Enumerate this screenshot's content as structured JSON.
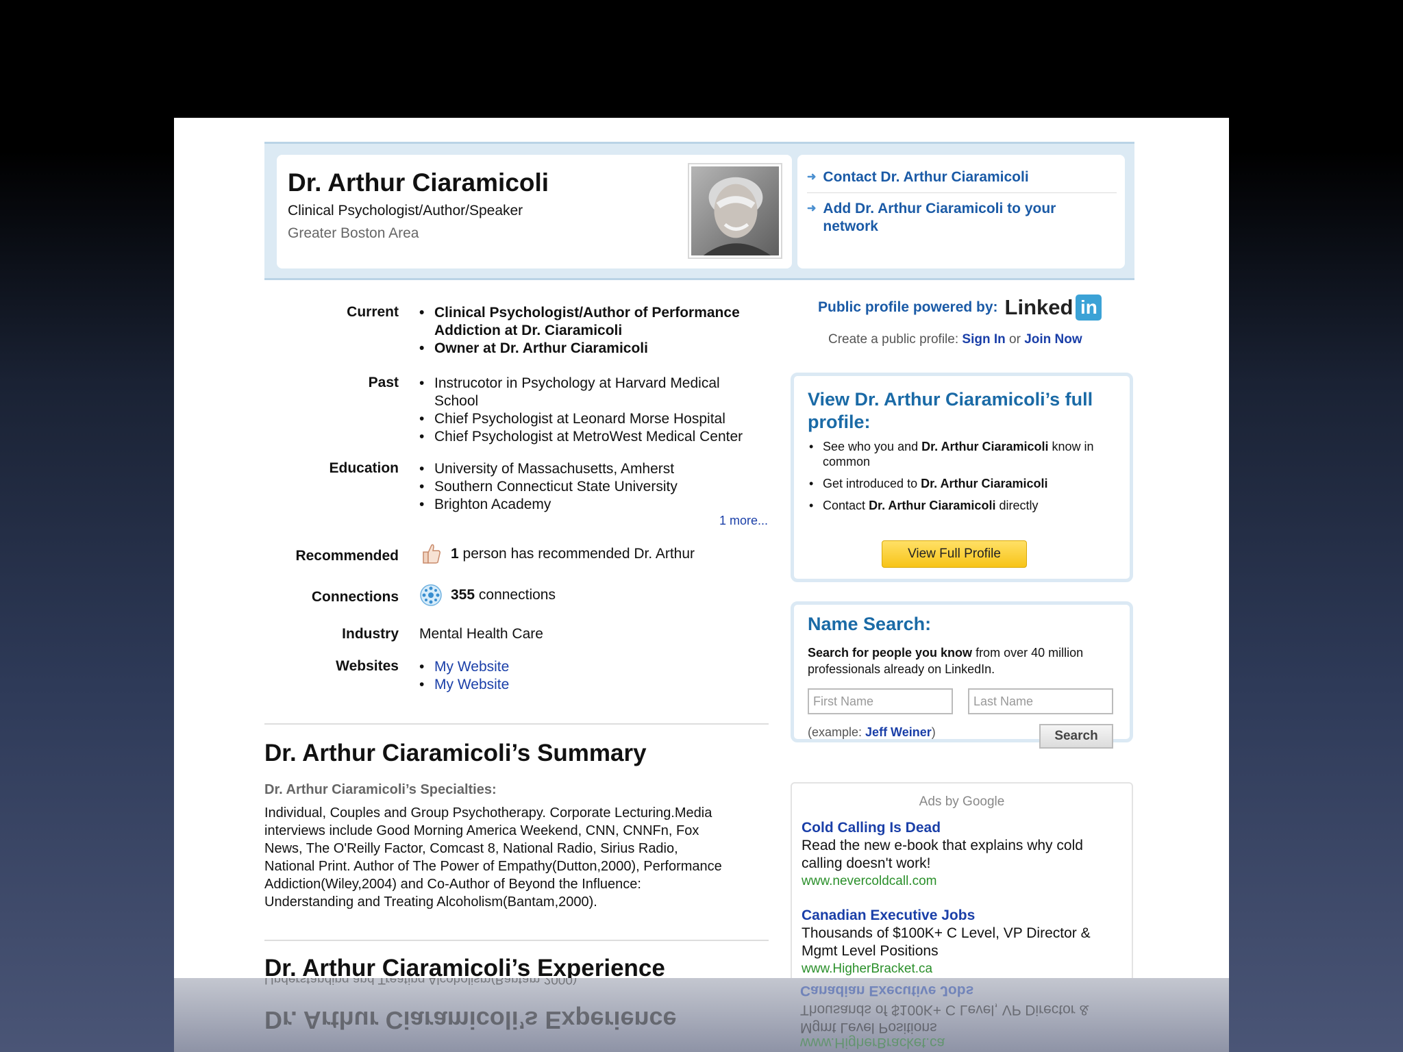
{
  "header": {
    "name": "Dr. Arthur Ciaramicoli",
    "headline": "Clinical Psychologist/Author/Speaker",
    "location": "Greater Boston Area",
    "actions": {
      "contact": "Contact Dr. Arthur Ciaramicoli",
      "add_line1": "Add Dr. Arthur Ciaramicoli to your",
      "add_line2": "network"
    }
  },
  "profile": {
    "current_label": "Current",
    "current": [
      "Clinical Psychologist/Author of Performance",
      "Addiction at Dr. Ciaramicoli",
      "Owner at Dr. Arthur Ciaramicoli"
    ],
    "past_label": "Past",
    "past": [
      "Instrucotor in Psychology at Harvard Medical",
      "School",
      "Chief Psychologist at Leonard Morse Hospital",
      "Chief Psychologist at MetroWest Medical Center"
    ],
    "education_label": "Education",
    "education": [
      "University of Massachusetts, Amherst",
      "Southern Connecticut State University",
      "Brighton Academy"
    ],
    "more_link": "1 more...",
    "recommended_label": "Recommended",
    "recommended_count": "1",
    "recommended_text": "person has recommended Dr. Arthur",
    "connections_label": "Connections",
    "connections_count": "355",
    "connections_text": "connections",
    "industry_label": "Industry",
    "industry": "Mental Health Care",
    "websites_label": "Websites",
    "websites": [
      "My Website",
      "My Website"
    ]
  },
  "summary": {
    "title": "Dr. Arthur Ciaramicoli’s Summary",
    "specialties_label": "Dr. Arthur Ciaramicoli’s Specialties:",
    "specialties_lines": [
      "Individual, Couples and Group Psychotherapy. Corporate Lecturing.Media",
      "interviews include Good Morning America Weekend, CNN, CNNFn, Fox",
      "News, The O'Reilly Factor, Comcast 8, National Radio, Sirius Radio,",
      "National Print. Author of The Power of Empathy(Dutton,2000), Performance",
      "Addiction(Wiley,2004) and Co-Author of Beyond the Influence:",
      "Understanding and Treating Alcoholism(Bantam,2000)."
    ],
    "experience_title": "Dr. Arthur Ciaramicoli’s Experience"
  },
  "sidebar": {
    "powered_by": "Public profile powered by:",
    "linkedin_word": "Linked",
    "linkedin_in": "in",
    "create_text": "Create a public profile:",
    "sign_in": "Sign In",
    "or": "or",
    "join_now": "Join Now",
    "full_profile": {
      "title_line1": "View Dr. Arthur Ciaramicoli’s full",
      "title_line2": "profile:",
      "b1_pre": "See who you and",
      "b1_name": "Dr. Arthur Ciaramicoli",
      "b1_post": "know in common",
      "b2_pre": "Get introduced to",
      "b2_name": "Dr. Arthur Ciaramicoli",
      "b3_pre": "Contact",
      "b3_name": "Dr. Arthur Ciaramicoli",
      "b3_post": "directly",
      "button": "View Full Profile"
    },
    "name_search": {
      "title": "Name Search:",
      "desc_bold": "Search for people you know",
      "desc_rest": "from over 40 million professionals already on LinkedIn.",
      "first_placeholder": "First Name",
      "last_placeholder": "Last Name",
      "example_pre": "(example:",
      "example_name": "Jeff Weiner",
      "example_post": ")",
      "button": "Search"
    },
    "ads": {
      "label": "Ads by Google",
      "items": [
        {
          "title": "Cold Calling Is Dead",
          "text": "Read the new e-book that explains why cold calling doesn't work!",
          "url": "www.nevercoldcall.com"
        },
        {
          "title": "Canadian Executive Jobs",
          "text": "Thousands of $100K+ C Level, VP Director & Mgmt Level Positions",
          "url": "www.HigherBracket.ca"
        }
      ]
    }
  },
  "reflection": {
    "title": "Dr. Arthur Ciaramicoli’s Experience",
    "ad_title": "Canadian Executive Jobs",
    "ad_line1": "Thousands of $100K+ C Level, VP Director &",
    "ad_line2": "Mgmt Level Positions",
    "ad_url": "www.HigherBracket.ca",
    "body": "Understanding and Treating Alcoholism(Bantam,2000)."
  }
}
